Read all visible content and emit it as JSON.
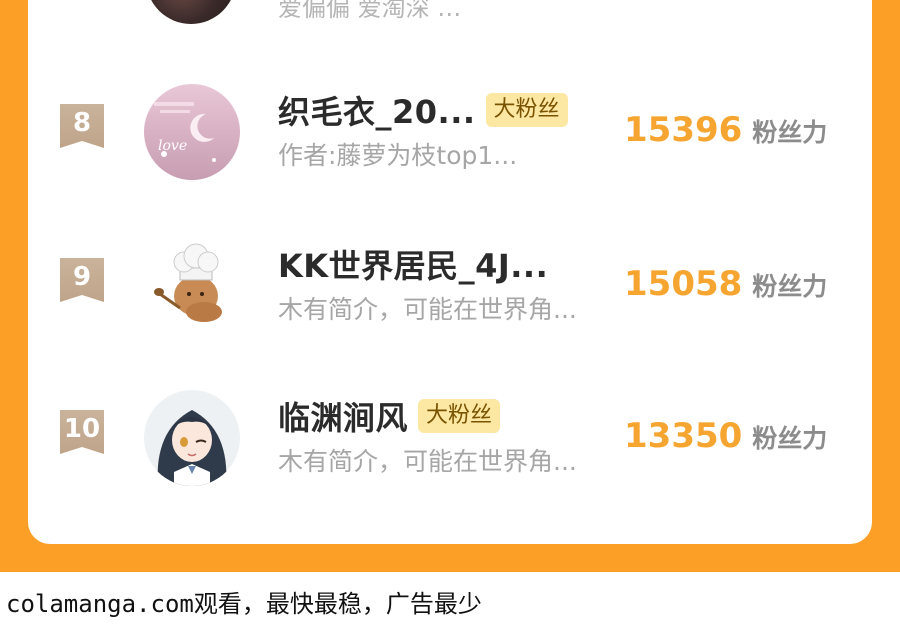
{
  "prev_row": {
    "desc": "爱偏偏 爱淘深 …"
  },
  "rows": [
    {
      "rank": "8",
      "name": "织毛衣_20...",
      "tag": "大粉丝",
      "desc": "作者:藤萝为枝top1...",
      "score": "15396",
      "unit": "粉丝力",
      "avatar_text": "love"
    },
    {
      "rank": "9",
      "name": "KK世界居民_4J...",
      "tag": "",
      "desc": "木有简介，可能在世界角...",
      "score": "15058",
      "unit": "粉丝力"
    },
    {
      "rank": "10",
      "name": "临渊涧风",
      "tag": "大粉丝",
      "desc": "木有简介，可能在世界角...",
      "score": "13350",
      "unit": "粉丝力"
    }
  ],
  "footer": {
    "text": "colamanga.com观看，最快最稳，广告最少"
  },
  "colors": {
    "frame": "#fb9f27",
    "score": "#f6a530",
    "badge": "#c4ab92",
    "tag_bg": "#fde8a3"
  }
}
